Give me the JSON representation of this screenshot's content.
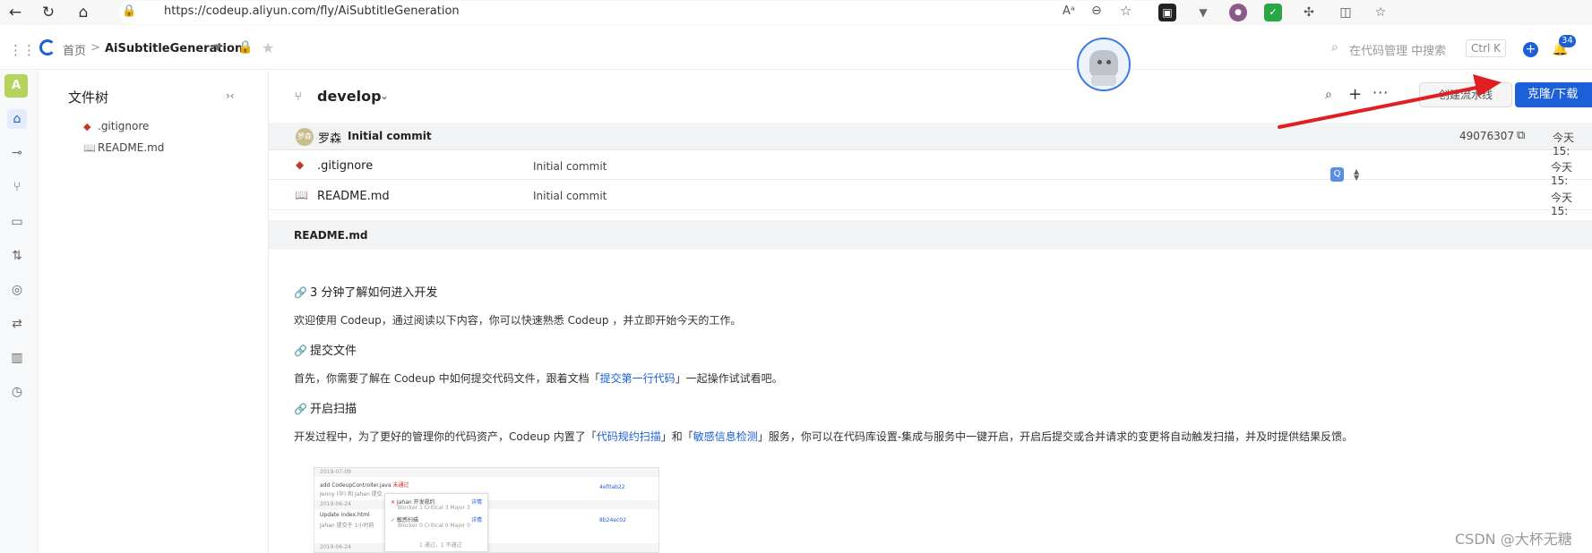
{
  "browser": {
    "url": "https://codeup.aliyun.com/fly/AiSubtitleGeneration",
    "reader_icon": "Aᵃ"
  },
  "header": {
    "home": "首页",
    "separator": ">",
    "repo": "AiSubtitleGeneration",
    "search_placeholder": "在代码管理 中搜索",
    "shortcut": "Ctrl K",
    "notifications": "34"
  },
  "rail": {
    "avatar": "A"
  },
  "tree": {
    "title": "文件树",
    "items": [
      ".gitignore",
      "README.md"
    ]
  },
  "toolbar": {
    "branch": "develop",
    "pipeline": "创建流水线",
    "clone": "克隆/下载"
  },
  "commit": {
    "avatar_text": "罗森",
    "author": "罗森",
    "message": "Initial commit",
    "hash": "49076307",
    "time": "今天 15:"
  },
  "files": [
    {
      "name": ".gitignore",
      "commit": "Initial commit",
      "time": "今天 15:"
    },
    {
      "name": "README.md",
      "commit": "Initial commit",
      "time": "今天 15:"
    }
  ],
  "readme": {
    "label": "README.md",
    "h1": "3 分钟了解如何进入开发",
    "p1": "欢迎使用 Codeup，通过阅读以下内容，你可以快速熟悉 Codeup ，并立即开始今天的工作。",
    "h2": "提交文件",
    "p2_a": "首先，你需要了解在 Codeup 中如何提交代码文件，跟着文档「",
    "p2_link": "提交第一行代码",
    "p2_b": "」一起操作试试看吧。",
    "h3": "开启扫描",
    "p3_a": "开发过程中，为了更好的管理你的代码资产，Codeup 内置了「",
    "p3_link1": "代码规约扫描",
    "p3_mid": "」和「",
    "p3_link2": "敏感信息检测",
    "p3_b": "」服务，你可以在代码库设置-集成与服务中一键开启，开启后提交或合并请求的变更将自动触发扫描，并及时提供结果反馈。"
  },
  "embedded_shot": {
    "date1": "2019-07-09",
    "row1": "add CodeupController.java",
    "row1_badge": "未通过",
    "row1_meta": "Jenny (华) 和 Jahan 提交",
    "popup1": "Jahan 开发规约",
    "popup1_sub": "Blocker 1 Critical 3 Major 3",
    "popup2": "敏感扫描",
    "popup2_sub": "Blocker 0 Critical 0 Major 0",
    "popup_detail": "详情",
    "popup_footer": "1 通过，1 不通过",
    "date2": "2019-06-24",
    "row2": "Update index.html",
    "row2_meta": "Jahan 提交于 1小时前",
    "hash1": "4ef0ab22",
    "hash2": "8b24ec02",
    "date3": "2019-06-24"
  },
  "watermark": "CSDN @大杯无糖",
  "colors": {
    "accent": "#1b5fd9",
    "arrow": "#e02020"
  }
}
